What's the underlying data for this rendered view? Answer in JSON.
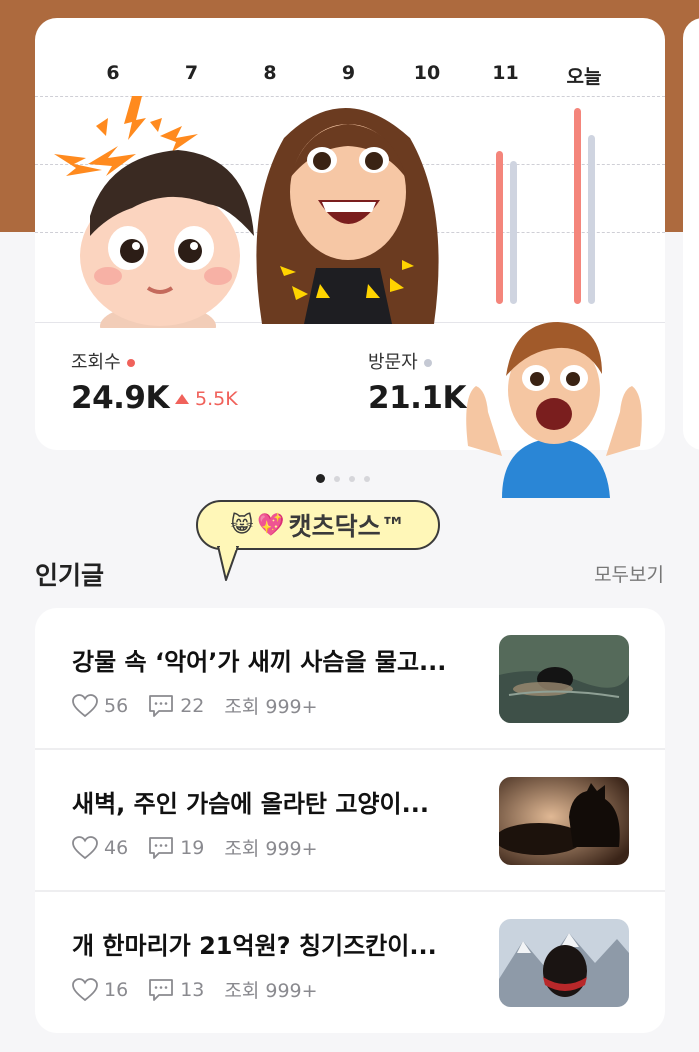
{
  "chart_data": {
    "type": "bar",
    "categories": [
      "6",
      "7",
      "8",
      "9",
      "10",
      "11",
      "오늘"
    ],
    "series": [
      {
        "name": "조회수",
        "values": [
          null,
          null,
          null,
          null,
          null,
          3.3,
          4.25
        ]
      },
      {
        "name": "방문자",
        "values": [
          null,
          null,
          null,
          null,
          null,
          3.1,
          3.65
        ]
      }
    ],
    "ylim": [
      0,
      4.5
    ],
    "grid": true,
    "colors": {
      "조회수": "#f4857b",
      "방문자": "#cfd4e0"
    }
  },
  "stats": {
    "views_label": "조회수",
    "views_value": "24.9K",
    "views_delta": "5.5K",
    "visitors_label": "방문자",
    "visitors_value": "21.1K"
  },
  "pager": {
    "count": 4,
    "active": 0
  },
  "sticker_bubble": {
    "text": "캣츠닥스™"
  },
  "popular": {
    "title": "인기글",
    "see_all": "모두보기",
    "posts": [
      {
        "title": "강물 속 ‘악어’가 새끼 사슴을 물고...",
        "likes": "56",
        "comments": "22",
        "views": "조회 999+"
      },
      {
        "title": "새벽, 주인 가슴에 올라탄 고양이...",
        "likes": "46",
        "comments": "19",
        "views": "조회 999+"
      },
      {
        "title": "개 한마리가 21억원? 칭기즈칸이...",
        "likes": "16",
        "comments": "13",
        "views": "조회 999+"
      }
    ]
  },
  "icons": {
    "like": "heart-outline-icon",
    "comment": "speech-bubble-icon"
  }
}
